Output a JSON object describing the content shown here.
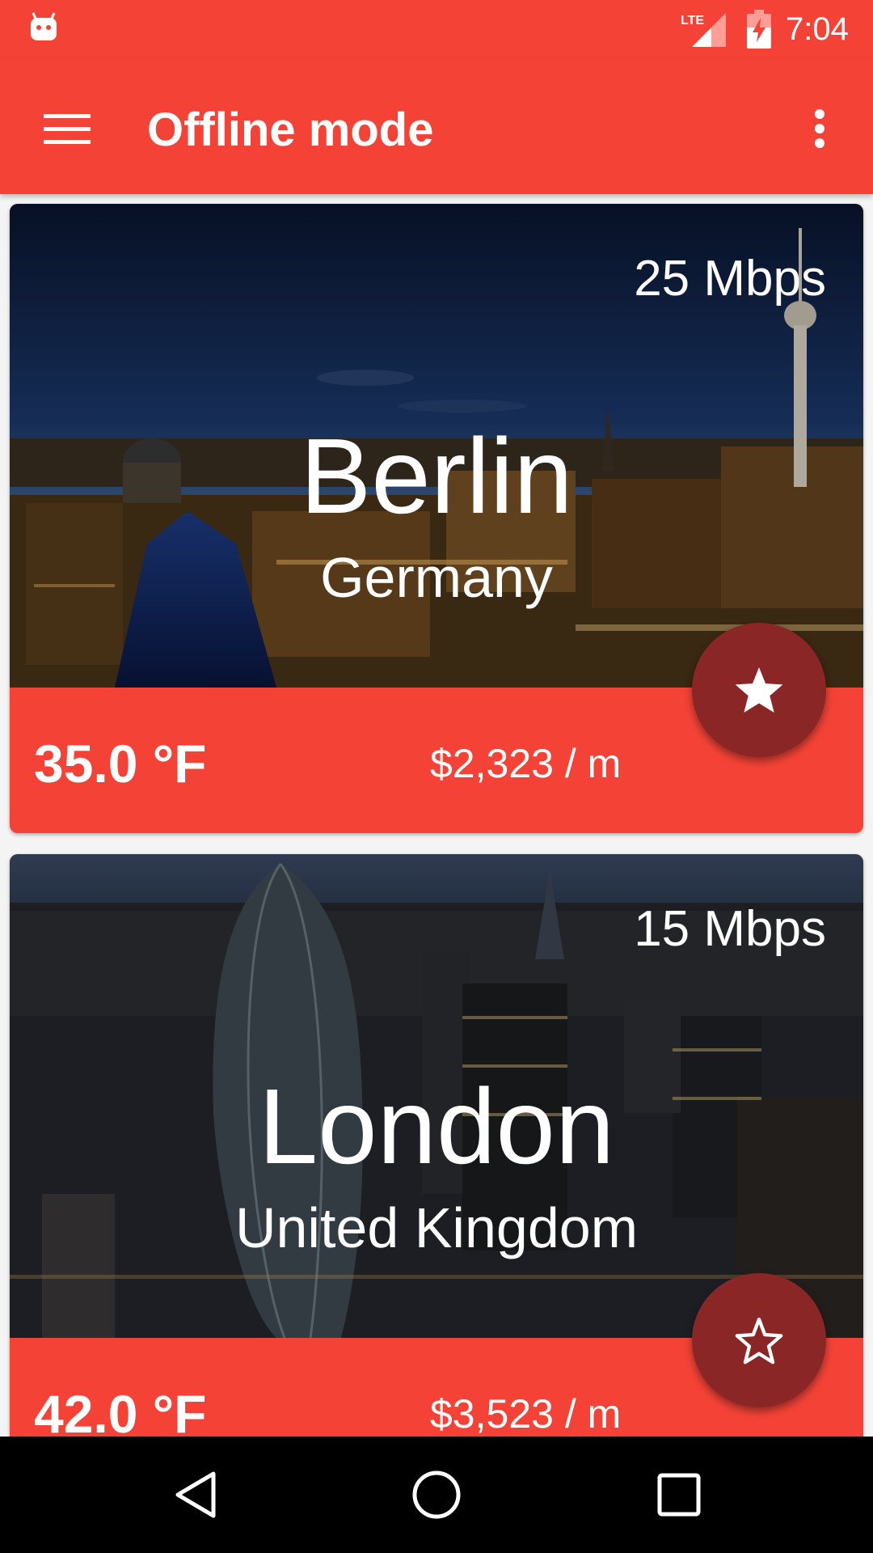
{
  "status_bar": {
    "time": "7:04",
    "network_label": "LTE",
    "icons": [
      "android-icon",
      "lte-signal-icon",
      "battery-charging-icon"
    ]
  },
  "app_bar": {
    "title": "Offline mode",
    "icons": [
      "hamburger-menu-icon",
      "more-vert-icon"
    ]
  },
  "colors": {
    "primary": "#f44336",
    "fab": "#8b2626",
    "text": "#ffffff",
    "nav_bar": "#000000"
  },
  "cities": [
    {
      "city": "Berlin",
      "country": "Germany",
      "speed": "25 Mbps",
      "temperature": "35.0 °F",
      "cost": "$2,323 / m",
      "favorite": true,
      "favorite_icon": "star-filled-icon"
    },
    {
      "city": "London",
      "country": "United Kingdom",
      "speed": "15 Mbps",
      "temperature": "42.0 °F",
      "cost": "$3,523 / m",
      "favorite": false,
      "favorite_icon": "star-outline-icon"
    }
  ],
  "nav_bar": {
    "icons": [
      "back-icon",
      "home-icon",
      "recents-icon"
    ]
  }
}
